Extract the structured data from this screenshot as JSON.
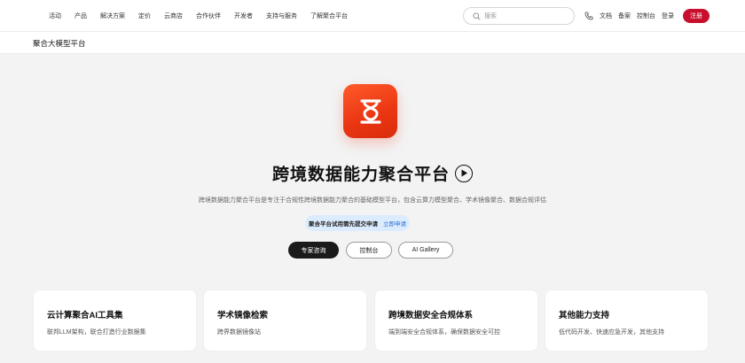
{
  "nav": {
    "items": [
      {
        "label": "活动"
      },
      {
        "label": "产品"
      },
      {
        "label": "解决方案"
      },
      {
        "label": "定价"
      },
      {
        "label": "云商店"
      },
      {
        "label": "合作伙伴"
      },
      {
        "label": "开发者"
      },
      {
        "label": "支持与服务"
      },
      {
        "label": "了解聚合平台"
      }
    ],
    "search_placeholder": "搜索",
    "docs": "文档",
    "filing": "备案",
    "console": "控制台",
    "login": "登录",
    "register": "注册"
  },
  "subbar": {
    "title": "聚合大模型平台"
  },
  "hero": {
    "title": "跨境数据能力聚合平台",
    "description": "跨境数据能力聚合平台是专注于合规性跨境数据能力聚合的基础模型平台，包含云算力模型聚合、学术镜像聚合、数据合规评估",
    "notice_text": "聚合平台试用需先提交申请",
    "notice_link": "立即申请",
    "btn_expert": "专家咨询",
    "btn_console": "控制台",
    "btn_gallery": "AI Gallery",
    "icon_color": "#ea3512"
  },
  "cards": [
    {
      "title": "云计算聚合AI工具集",
      "desc": "联邦LLM架构，联合打造行业数据集"
    },
    {
      "title": "学术镜像检索",
      "desc": "跨界数据镜像站"
    },
    {
      "title": "跨境数据安全合规体系",
      "desc": "端到端安全合规体系，确保数据安全可控"
    },
    {
      "title": "其他能力支持",
      "desc": "低代码开发、快速应急开发，其他支持"
    }
  ],
  "colors": {
    "brand_red": "#c8102e",
    "notice_bg": "#dcecff",
    "link_blue": "#2c6ed6"
  }
}
